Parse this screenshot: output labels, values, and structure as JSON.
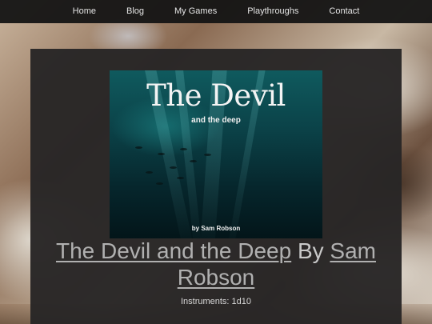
{
  "nav": {
    "items": [
      "Home",
      "Blog",
      "My Games",
      "Playthroughs",
      "Contact"
    ]
  },
  "cover": {
    "title": "The Devil",
    "subtitle": "and the deep",
    "author": "by Sam Robson"
  },
  "game": {
    "title_link": "The Devil and the Deep",
    "by": "By",
    "author_link": "Sam Robson",
    "instruments": "Instruments: 1d10"
  }
}
